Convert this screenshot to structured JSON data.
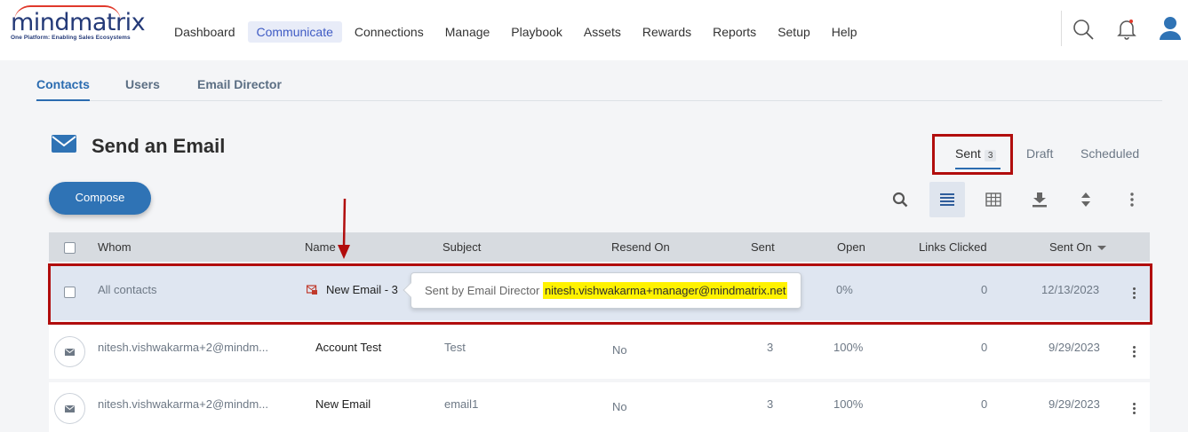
{
  "brand": {
    "name": "mindmatrix",
    "tagline": "One Platform: Enabling Sales Ecosystems"
  },
  "nav": [
    {
      "label": "Dashboard"
    },
    {
      "label": "Communicate",
      "active": true
    },
    {
      "label": "Connections"
    },
    {
      "label": "Manage"
    },
    {
      "label": "Playbook"
    },
    {
      "label": "Assets"
    },
    {
      "label": "Rewards"
    },
    {
      "label": "Reports"
    },
    {
      "label": "Setup"
    },
    {
      "label": "Help"
    }
  ],
  "top_icons": [
    "search-icon",
    "bell-icon",
    "user-icon"
  ],
  "subtabs": [
    {
      "label": "Contacts",
      "active": true
    },
    {
      "label": "Users"
    },
    {
      "label": "Email Director"
    }
  ],
  "page": {
    "title": "Send an Email",
    "compose_label": "Compose",
    "view_tabs": {
      "sent": "Sent",
      "sent_count": "3",
      "draft": "Draft",
      "scheduled": "Scheduled"
    }
  },
  "toolbar": [
    "search-icon",
    "list-view-icon",
    "grid-view-icon",
    "download-icon",
    "sort-icon",
    "more-icon"
  ],
  "table": {
    "headers": {
      "whom": "Whom",
      "name": "Name",
      "subject": "Subject",
      "resend": "Resend On",
      "sent": "Sent",
      "open": "Open",
      "links": "Links Clicked",
      "sent_on": "Sent On"
    },
    "rows": [
      {
        "whom": "All contacts",
        "name": "New Email - 3",
        "subject": "",
        "resend": "",
        "sent": "",
        "open": "0%",
        "links": "0",
        "sent_on": "12/13/2023"
      },
      {
        "whom": "nitesh.vishwakarma+2@mindm...",
        "name": "Account Test",
        "subject": "Test",
        "resend": "No",
        "sent": "3",
        "open": "100%",
        "links": "0",
        "sent_on": "9/29/2023"
      },
      {
        "whom": "nitesh.vishwakarma+2@mindm...",
        "name": "New Email",
        "subject": "email1",
        "resend": "No",
        "sent": "3",
        "open": "100%",
        "links": "0",
        "sent_on": "9/29/2023"
      }
    ]
  },
  "tooltip": {
    "prefix": "Sent by Email Director",
    "email": "nitesh.vishwakarma+manager@mindmatrix.net"
  },
  "colors": {
    "accent": "#2f73b5",
    "highlight_box": "#b10d0d",
    "highlight_text": "#fff200"
  }
}
